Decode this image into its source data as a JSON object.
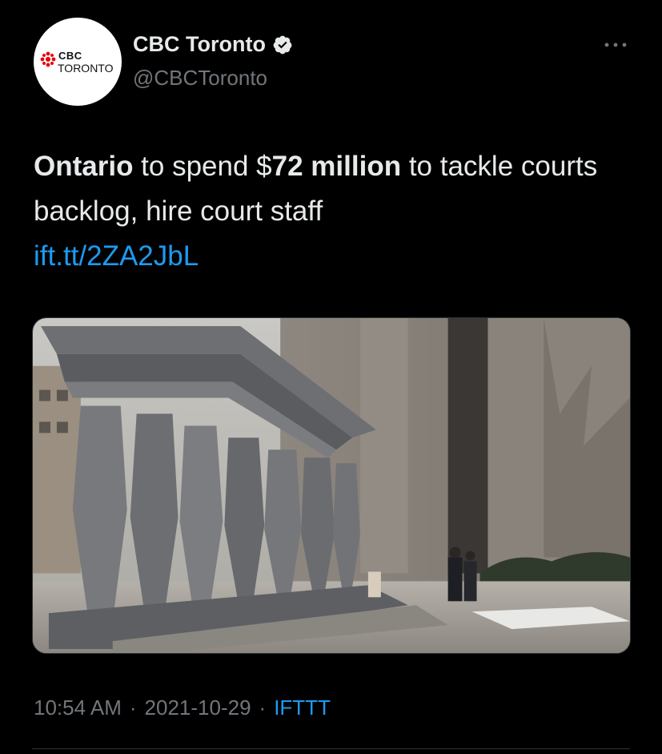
{
  "account": {
    "display_name": "CBC Toronto",
    "handle": "@CBCToronto",
    "avatar_logo_text": "CBC",
    "avatar_city_text": "TORONTO",
    "verified": true
  },
  "tweet": {
    "text_parts": {
      "bold1": "Ontario",
      "plain1": " to spend $",
      "bold2": "72 million",
      "plain2": " to tackle courts backlog, hire court staff"
    },
    "link": "ift.tt/2ZA2JbL"
  },
  "meta": {
    "time": "10:54 AM",
    "separator": "·",
    "date": "2021-10-29",
    "source": "IFTTT"
  },
  "colors": {
    "background": "#000000",
    "text": "#e7e9ea",
    "secondary": "#71767b",
    "link": "#1d9bf0",
    "cbc_red": "#e60505"
  },
  "icons": {
    "verified": "verified-badge-icon",
    "more": "more-options-icon"
  }
}
